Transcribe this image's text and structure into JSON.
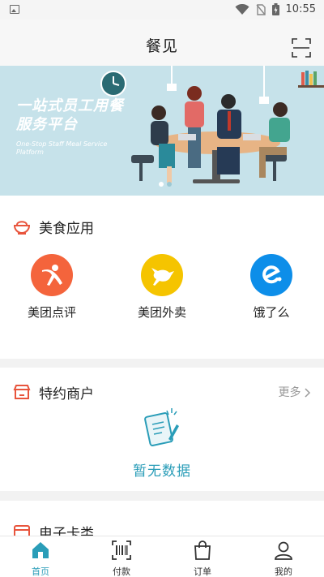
{
  "status_bar": {
    "time": "10:55"
  },
  "header": {
    "title": "餐见"
  },
  "banner": {
    "title": "一站式员工用餐服务平台",
    "subtitle": "One-Stop Staff Meal Service Platform"
  },
  "food_apps": {
    "title": "美食应用",
    "items": [
      {
        "label": "美团点评",
        "icon": "dianping-icon",
        "color": "#f4643c"
      },
      {
        "label": "美团外卖",
        "icon": "kangaroo-icon",
        "color": "#f5c400"
      },
      {
        "label": "饿了么",
        "icon": "eleme-icon",
        "color": "#0d8ee9"
      }
    ]
  },
  "merchants": {
    "title": "特约商户",
    "more": "更多",
    "empty": "暂无数据"
  },
  "cards": {
    "title": "电子卡类"
  },
  "tabs": [
    {
      "label": "首页",
      "icon": "home-icon"
    },
    {
      "label": "付款",
      "icon": "barcode-icon"
    },
    {
      "label": "订单",
      "icon": "bag-icon"
    },
    {
      "label": "我的",
      "icon": "user-icon"
    }
  ],
  "colors": {
    "accent": "#2a9db8",
    "section_icon": "#e8543c"
  }
}
